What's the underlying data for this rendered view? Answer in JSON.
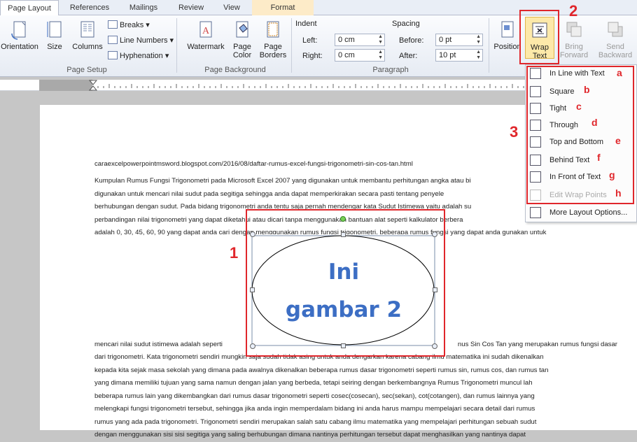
{
  "tabs": {
    "page_layout": "Page Layout",
    "references": "References",
    "mailings": "Mailings",
    "review": "Review",
    "view": "View",
    "format": "Format"
  },
  "page_setup": {
    "orientation": "Orientation",
    "size": "Size",
    "columns": "Columns",
    "breaks": "Breaks",
    "line_numbers": "Line Numbers",
    "hyphenation": "Hyphenation",
    "group": "Page Setup"
  },
  "page_background": {
    "watermark": "Watermark",
    "page_color_1": "Page",
    "page_color_2": "Color",
    "page_borders_1": "Page",
    "page_borders_2": "Borders",
    "group": "Page Background"
  },
  "paragraph": {
    "indent": "Indent",
    "left_label": "Left:",
    "left_value": "0 cm",
    "right_label": "Right:",
    "right_value": "0 cm",
    "spacing": "Spacing",
    "before_label": "Before:",
    "before_value": "0 pt",
    "after_label": "After:",
    "after_value": "10 pt",
    "group": "Paragraph"
  },
  "arrange": {
    "position": "Position",
    "wrap_1": "Wrap",
    "wrap_2": "Text",
    "bring_1": "Bring",
    "bring_2": "Forward",
    "send_1": "Send",
    "send_2": "Backward"
  },
  "menu": {
    "items": [
      {
        "label": "In Line with Text",
        "tag": "a"
      },
      {
        "label": "Square",
        "tag": "b"
      },
      {
        "label": "Tight",
        "tag": "c"
      },
      {
        "label": "Through",
        "tag": "d"
      },
      {
        "label": "Top and Bottom",
        "tag": "e"
      },
      {
        "label": "Behind Text",
        "tag": "f"
      },
      {
        "label": "In Front of Text",
        "tag": "g"
      },
      {
        "label": "Edit Wrap Points",
        "tag": "h"
      }
    ],
    "more": "More Layout Options..."
  },
  "annotations": {
    "n1": "1",
    "n2": "2",
    "n3": "3"
  },
  "shape": {
    "line1": "Ini",
    "line2": "gambar 2"
  },
  "document": {
    "url": "caraexcelpowerpointmsword.blogspot.com/2016/08/daftar-rumus-excel-fungsi-trigonometri-sin-cos-tan.html",
    "p1": [
      "Kumpulan Rumus Fungsi Trigonometri pada Microsoft Excel 2007 yang digunakan untuk membantu perhitungan angka atau bi",
      "digunakan untuk mencari nilai sudut pada segitiga sehingga anda dapat memperkirakan secara pasti tentang penyele",
      "berhubungan dengan sudut. Pada bidang trigonometri anda tentu saja pernah mendengar kata Sudut Istimewa yaitu adalah su",
      "perbandingan nilai trigonometri yang dapat diketahui atau dicari tanpa menggunakan bantuan alat seperti kalkulator berbera",
      "adalah 0, 30, 45, 60, 90 yang dapat anda cari dengan menggunakan rumus fungsi trigonometri, beberapa rumus fungsi yang dapat anda gunakan untuk"
    ],
    "p2_first_left": "mencari nilai sudut istimewa adalah seperti",
    "p2_first_right": "nus Sin Cos Tan yang merupakan rumus fungsi dasar",
    "p2": [
      "dari trigonometri. Kata trigonometri sendiri mungkin saja sudah tidak asing untuk anda dengarkan karena cabang ilmu matematika ini sudah dikenalkan",
      "kepada kita sejak masa sekolah yang dimana pada awalnya dikenalkan beberapa rumus dasar trigonometri seperti rumus sin, rumus cos, dan rumus tan",
      "yang dimana memiliki tujuan yang sama namun dengan jalan yang berbeda, tetapi seiring dengan berkembangnya Rumus Trigonometri muncul lah",
      "beberapa rumus lain yang dikembangkan dari rumus dasar trigonometri seperti cosec(cosecan), sec(sekan), cot(cotangen), dan rumus lainnya yang",
      "melengkapi fungsi trigonometri tersebut,  sehingga jika anda ingin memperdalam bidang ini anda harus mampu mempelajari secara detail dari rumus",
      "rumus yang ada pada trigonometri. Trigonometri sendiri merupakan salah satu cabang ilmu matematika yang mempelajari perhitungan sebuah sudut",
      "dengan menggunakan sisi sisi segitiga yang saling berhubungan dimana nantinya perhitungan tersebut dapat menghasilkan yang nantinya dapat"
    ]
  }
}
